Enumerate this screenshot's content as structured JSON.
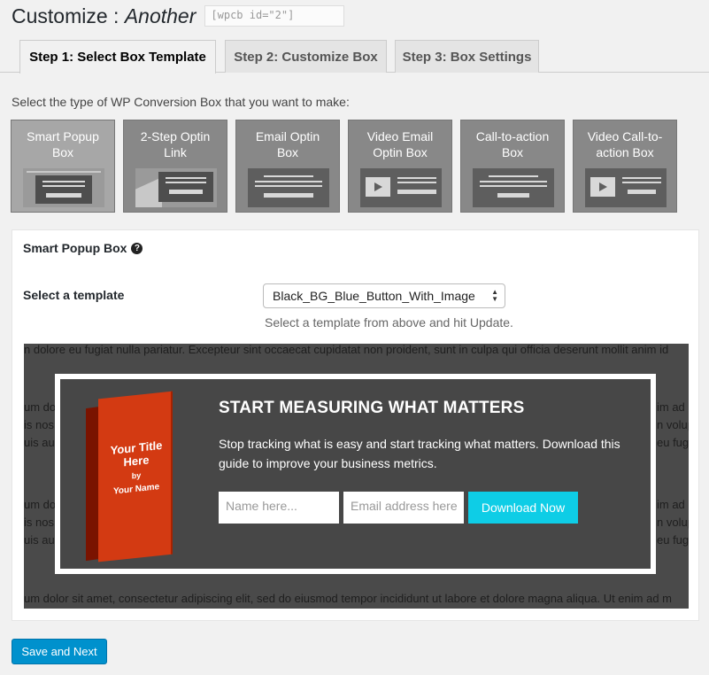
{
  "header": {
    "title_prefix": "Customize : ",
    "title_name": "Another",
    "shortcode": "[wpcb id=\"2\"]"
  },
  "tabs": [
    {
      "label": "Step 1: Select Box Template",
      "active": true
    },
    {
      "label": "Step 2: Customize Box",
      "active": false
    },
    {
      "label": "Step 3: Box Settings",
      "active": false
    }
  ],
  "intro_text": "Select the type of WP Conversion Box that you want to make:",
  "box_types": [
    {
      "label": "Smart Popup\nBox",
      "selected": true
    },
    {
      "label": "2-Step Optin\nLink",
      "selected": false
    },
    {
      "label": "Email Optin\nBox",
      "selected": false
    },
    {
      "label": "Video Email\nOptin Box",
      "selected": false
    },
    {
      "label": "Call-to-action\nBox",
      "selected": false
    },
    {
      "label": "Video Call-to-\naction Box",
      "selected": false
    }
  ],
  "panel": {
    "heading": "Smart Popup Box",
    "help_icon": "?",
    "select_label": "Select a template",
    "select_value": "Black_BG_Blue_Button_With_Image",
    "select_hint": "Select a template from above and hit Update."
  },
  "preview": {
    "lorem_top": "n dolore eu fugiat nulla pariatur. Excepteur sint occaecat cupidatat non proident, sunt in culpa qui officia deserunt mollit anim id",
    "lorem_bottom": "um dolor sit amet, consectetur adipiscing elit, sed do eiusmod tempor incididunt ut labore et dolore magna aliqua. Ut enim ad m",
    "side_left": [
      "um dol",
      "is nos",
      "uis au",
      "um dol",
      "is nos",
      "uis au"
    ],
    "side_right": [
      "im ad r",
      "n volup",
      "eu fug",
      "im ad r",
      "n volup",
      "eu fug"
    ],
    "book_title": "Your Title Here",
    "book_by": "by",
    "book_author": "Your Name",
    "heading": "START MEASURING WHAT MATTERS",
    "body": "Stop tracking what is easy and start tracking what matters. Download this guide to improve your business metrics.",
    "name_placeholder": "Name here...",
    "email_placeholder": "Email address here",
    "button_label": "Download Now",
    "button_color": "#0ecde6"
  },
  "footer": {
    "save_label": "Save and Next"
  }
}
